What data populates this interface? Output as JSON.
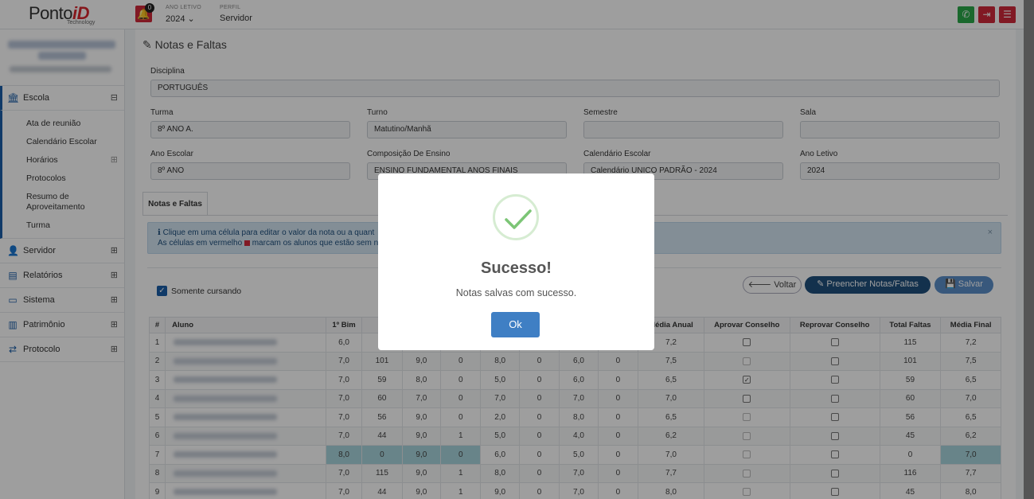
{
  "brand": {
    "name_main": "Ponto",
    "name_accent": "iD",
    "tagline": "Technology"
  },
  "topbar": {
    "notification_count": "0",
    "ano_letivo_label": "ANO LETIVO",
    "ano_letivo_value": "2024 ⌄",
    "perfil_label": "PERFIL",
    "perfil_value": "Servidor",
    "colors": {
      "whatsapp": "#2aa84a",
      "logout": "#d0293b",
      "menu": "#d0293b"
    }
  },
  "sidebar": {
    "escola": {
      "label": "Escola",
      "toggle": "⊟"
    },
    "escola_items": [
      "Ata de reunião",
      "Calendário Escolar",
      "Horários",
      "Protocolos",
      "Resumo de Aproveitamento",
      "Turma"
    ],
    "horarios_toggle": "⊞",
    "items": [
      {
        "label": "Servidor",
        "toggle": "⊞"
      },
      {
        "label": "Relatórios",
        "toggle": "⊞"
      },
      {
        "label": "Sistema",
        "toggle": "⊞"
      },
      {
        "label": "Patrimônio",
        "toggle": "⊞"
      },
      {
        "label": "Protocolo",
        "toggle": "⊞"
      }
    ]
  },
  "page": {
    "title": "Notas e Faltas"
  },
  "form": {
    "disciplina_label": "Disciplina",
    "disciplina_value": "PORTUGUÊS",
    "turma_label": "Turma",
    "turma_value": "8º ANO A.",
    "turno_label": "Turno",
    "turno_value": "Matutino/Manhã",
    "semestre_label": "Semestre",
    "semestre_value": "",
    "sala_label": "Sala",
    "sala_value": "",
    "ano_escolar_label": "Ano Escolar",
    "ano_escolar_value": "8º ANO",
    "composicao_label": "Composição De Ensino",
    "composicao_value": "ENSINO FUNDAMENTAL ANOS FINAIS",
    "calendario_label": "Calendário Escolar",
    "calendario_value": "Calendário UNICO PADRÃO - 2024",
    "ano_letivo_label": "Ano Letivo",
    "ano_letivo_value": "2024"
  },
  "tab": {
    "label": "Notas e Faltas"
  },
  "info": {
    "line1": "Clique em uma célula para editar o valor da nota ou a quant",
    "line2_a": "As células em vermelho",
    "line2_b": "marcam os alunos que estão sem no"
  },
  "controls": {
    "somente_cursando": "Somente cursando",
    "voltar": "Voltar",
    "preencher": "Preencher Notas/Faltas",
    "salvar": "Salvar"
  },
  "table": {
    "headers": [
      "#",
      "Aluno",
      "1º Bim",
      "Fa",
      "",
      "",
      "",
      "",
      "",
      "",
      "Média Anual",
      "Aprovar Conselho",
      "Reprovar Conselho",
      "Total Faltas",
      "Média Final"
    ],
    "rows": [
      {
        "n": "1",
        "b1": "6,0",
        "f1": "",
        "b2": "",
        "f2": "",
        "b3": "",
        "f3": "",
        "b4": "",
        "f4": "",
        "media": "7,2",
        "ap": false,
        "ap_dim": false,
        "rp": false,
        "faltas": "115",
        "final": "7,2"
      },
      {
        "n": "2",
        "b1": "7,0",
        "f1": "101",
        "b2": "9,0",
        "f2": "0",
        "b3": "8,0",
        "f3": "0",
        "b4": "6,0",
        "f4": "0",
        "media": "7,5",
        "ap": false,
        "ap_dim": true,
        "rp": false,
        "faltas": "101",
        "final": "7,5"
      },
      {
        "n": "3",
        "b1": "7,0",
        "f1": "59",
        "b2": "8,0",
        "f2": "0",
        "b3": "5,0",
        "f3": "0",
        "b4": "6,0",
        "f4": "0",
        "media": "6,5",
        "ap": true,
        "ap_dim": false,
        "rp": false,
        "faltas": "59",
        "final": "6,5"
      },
      {
        "n": "4",
        "b1": "7,0",
        "f1": "60",
        "b2": "7,0",
        "f2": "0",
        "b3": "7,0",
        "f3": "0",
        "b4": "7,0",
        "f4": "0",
        "media": "7,0",
        "ap": false,
        "ap_dim": false,
        "rp": false,
        "faltas": "60",
        "final": "7,0"
      },
      {
        "n": "5",
        "b1": "7,0",
        "f1": "56",
        "b2": "9,0",
        "f2": "0",
        "b3": "2,0",
        "f3": "0",
        "b4": "8,0",
        "f4": "0",
        "media": "6,5",
        "ap": false,
        "ap_dim": true,
        "rp": false,
        "faltas": "56",
        "final": "6,5"
      },
      {
        "n": "6",
        "b1": "7,0",
        "f1": "44",
        "b2": "9,0",
        "f2": "1",
        "b3": "5,0",
        "f3": "0",
        "b4": "4,0",
        "f4": "0",
        "media": "6,2",
        "ap": false,
        "ap_dim": true,
        "rp": false,
        "faltas": "45",
        "final": "6,2"
      },
      {
        "n": "7",
        "b1": "8,0",
        "f1": "0",
        "b2": "9,0",
        "f2": "0",
        "b3": "6,0",
        "f3": "0",
        "b4": "5,0",
        "f4": "0",
        "media": "7,0",
        "ap": false,
        "ap_dim": true,
        "rp": false,
        "faltas": "0",
        "final": "7,0"
      },
      {
        "n": "8",
        "b1": "7,0",
        "f1": "115",
        "b2": "9,0",
        "f2": "1",
        "b3": "8,0",
        "f3": "0",
        "b4": "7,0",
        "f4": "0",
        "media": "7,7",
        "ap": false,
        "ap_dim": true,
        "rp": false,
        "faltas": "116",
        "final": "7,7"
      },
      {
        "n": "9",
        "b1": "7,0",
        "f1": "44",
        "b2": "9,0",
        "f2": "1",
        "b3": "9,0",
        "f3": "0",
        "b4": "7,0",
        "f4": "0",
        "media": "8,0",
        "ap": false,
        "ap_dim": true,
        "rp": false,
        "faltas": "45",
        "final": "8,0"
      }
    ]
  },
  "modal": {
    "title": "Sucesso!",
    "message": "Notas salvas com sucesso.",
    "ok": "Ok",
    "accent": "#3f7fc4",
    "check_color": "#7cc576"
  }
}
